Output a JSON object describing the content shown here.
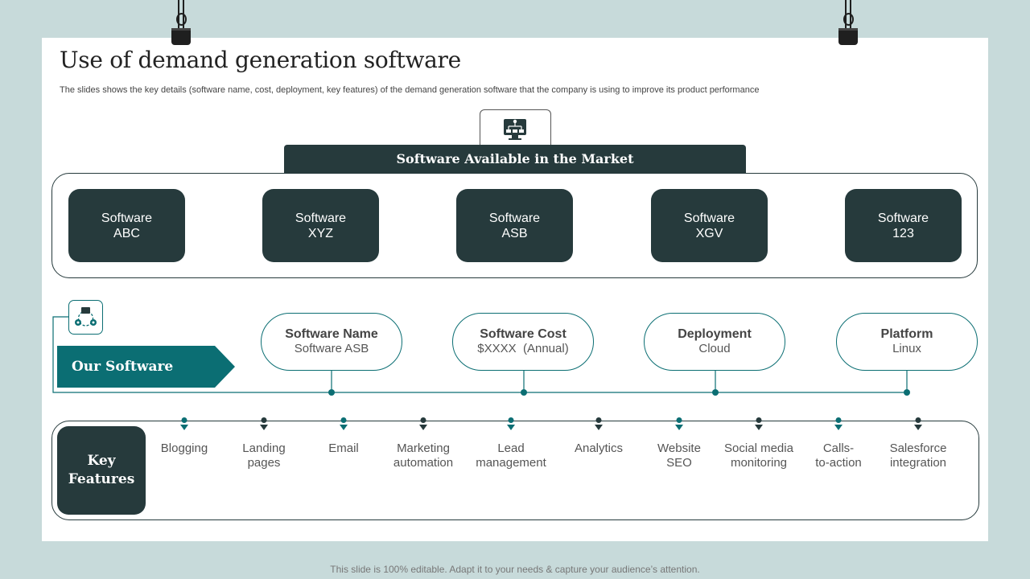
{
  "title": "Use of demand generation software",
  "subtitle": "The slides shows the key details (software name, cost, deployment, key features) of the demand generation software that the company is using to improve its product performance",
  "market": {
    "header": "Software Available in the Market",
    "items": [
      "Software\nABC",
      "Software\nXYZ",
      "Software\nASB",
      "Software\nXGV",
      "Software\n123"
    ]
  },
  "our_software": {
    "label": "Our Software",
    "attributes": [
      {
        "label": "Software Name",
        "value": "Software ASB"
      },
      {
        "label": "Software Cost",
        "value": "$XXXX  (Annual)"
      },
      {
        "label": "Deployment",
        "value": "Cloud"
      },
      {
        "label": "Platform",
        "value": "Linux"
      }
    ]
  },
  "key_features": {
    "label": "Key\nFeatures",
    "items": [
      "Blogging",
      "Landing\npages",
      "Email",
      "Marketing\nautomation",
      "Lead\nmanagement",
      "Analytics",
      "Website\nSEO",
      "Social media\nmonitoring",
      "Calls-\nto-action",
      "Salesforce\nintegration"
    ]
  },
  "footer": "This slide is 100% editable. Adapt it to your needs & capture your audience’s attention.",
  "colors": {
    "dark": "#263a3c",
    "teal": "#0b6e73",
    "background": "#c7dada"
  },
  "icons": {
    "market": "monitor-network-icon",
    "our_software": "cycle-process-icon",
    "clips": "binder-clip-icon"
  }
}
